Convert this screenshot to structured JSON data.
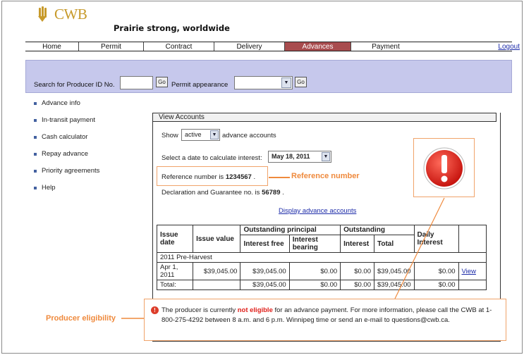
{
  "brand": {
    "logo_text": "CWB",
    "tagline": "Prairie strong, worldwide",
    "gold": "#c79a2b"
  },
  "nav": {
    "items": [
      "Home",
      "Permit",
      "Contract",
      "Delivery",
      "Advances",
      "Payment"
    ],
    "active": "Advances",
    "logout": "Logout",
    "active_color": "#a84c4e"
  },
  "search": {
    "producer_label": "Search for Producer ID No.",
    "producer_value": "",
    "go_label": "Go",
    "permit_label": "Permit appearance",
    "permit_value": ""
  },
  "sidebar": {
    "items": [
      {
        "label": "Advance info"
      },
      {
        "label": "In-transit payment"
      },
      {
        "label": "Cash calculator"
      },
      {
        "label": "Repay advance"
      },
      {
        "label": "Priority agreements"
      },
      {
        "label": "Help"
      }
    ]
  },
  "view_accounts": {
    "title": "View Accounts",
    "show_label": "Show",
    "show_value": "active",
    "show_suffix": "advance accounts",
    "date_label": "Select a date to calculate interest:",
    "date_value": "May 18, 2011",
    "ref_prefix": "Reference number is",
    "ref_value": "1234567",
    "ref_suffix": ".",
    "decl_prefix": "Declaration and Guarantee no. is",
    "decl_value": "56789",
    "decl_suffix": ".",
    "display_link": "Display advance accounts"
  },
  "table": {
    "headers": {
      "issue_date": "Issue date",
      "issue_value": "Issue value",
      "outstanding_principal": "Outstanding principal",
      "interest_free": "Interest free",
      "interest_bearing": "Interest bearing",
      "outstanding": "Outstanding",
      "interest": "Interest",
      "total": "Total",
      "daily_interest": "Daily Interest"
    },
    "group_label": "2011 Pre-Harvest",
    "row": {
      "date": "Apr 1, 2011",
      "issue_value": "$39,045.00",
      "interest_free": "$39,045.00",
      "interest_bearing": "$0.00",
      "interest": "$0.00",
      "total": "$39,045.00",
      "daily": "$0.00",
      "view": "View"
    },
    "total_row": {
      "label": "Total:",
      "interest_free": "$39,045.00",
      "interest_bearing": "$0.00",
      "interest": "$0.00",
      "total": "$39,045.00",
      "daily": "$0.00"
    }
  },
  "eligibility": {
    "before": "The producer is currently",
    "highlight": "not eligible",
    "after": "for an advance payment. For more information, please call the CWB at 1-800-275-4292 between 8 a.m. and 6 p.m. Winnipeg time or send an e-mail to questions@cwb.ca."
  },
  "callouts": {
    "reference": "Reference number",
    "eligibility": "Producer eligibility",
    "color": "#ef8a3d"
  }
}
